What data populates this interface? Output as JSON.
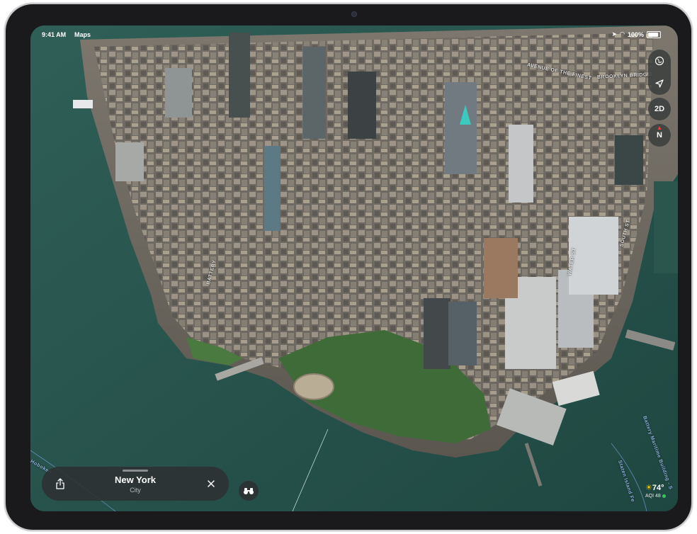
{
  "status_bar": {
    "time": "9:41 AM",
    "app_name": "Maps",
    "battery": "100%"
  },
  "map_controls": {
    "globe_icon": "globe-icon",
    "location_icon": "location-arrow-icon",
    "view_mode_label": "2D",
    "compass_label": "N"
  },
  "place_card": {
    "title": "New York",
    "subtitle": "City"
  },
  "weather": {
    "temperature": "74°",
    "aqi": "AQI 48",
    "aqi_color": "#34c759",
    "sun_color": "#ffcc00"
  },
  "street_labels": {
    "avenue_of_finest": "AVENUE OF THE FINEST",
    "brooklyn_bridge": "BROOKLYN BRIDGE",
    "battery_maritime": "Battery Maritime Building - S",
    "staten_island": "Staten Island Fe",
    "hoboken": "Hoboken",
    "water_st": "WATER ST",
    "south_st": "SOUTH ST",
    "battery": "BATTERY"
  },
  "colors": {
    "water": "#2e5a50",
    "accent_teal": "#3cc9c0"
  }
}
